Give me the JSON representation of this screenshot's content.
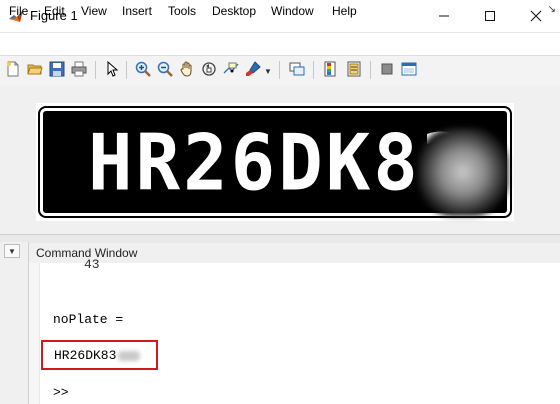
{
  "window": {
    "title": "Figure 1",
    "minimize_icon": "minimize-icon",
    "maximize_icon": "maximize-icon",
    "close_icon": "close-icon"
  },
  "menu": {
    "items": [
      "File",
      "Edit",
      "View",
      "Insert",
      "Tools",
      "Desktop",
      "Window",
      "Help"
    ],
    "dock_icon": "dock-arrow-icon"
  },
  "toolbar": {
    "icons": [
      "new-figure-icon",
      "open-file-icon",
      "save-icon",
      "print-icon",
      "edit-plot-arrow-icon",
      "zoom-in-icon",
      "zoom-out-icon",
      "pan-hand-icon",
      "rotate-3d-icon",
      "data-cursor-icon",
      "brush-icon",
      "brush-dropdown-icon",
      "link-plot-icon",
      "insert-colorbar-icon",
      "insert-legend-icon",
      "hide-plot-tools-icon",
      "show-plot-tools-icon"
    ]
  },
  "figure": {
    "plate_text": "HR26DK83"
  },
  "command_window": {
    "title": "Command Window",
    "prev_output": "43",
    "variable_line": "noPlate =",
    "result": "HR26DK83",
    "prompt": ">>",
    "highlight_color": "#d3191c"
  }
}
